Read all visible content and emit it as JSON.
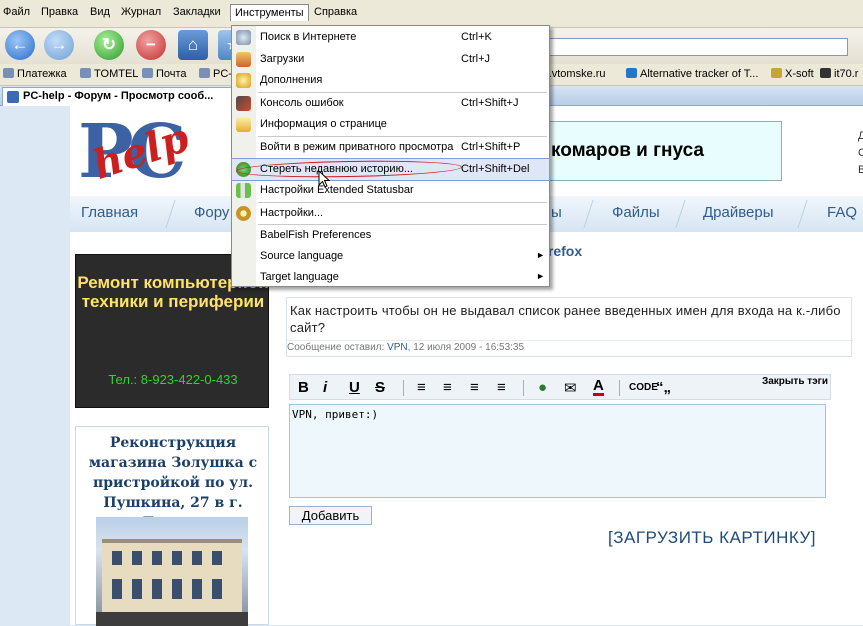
{
  "menubar": {
    "items": [
      "Файл",
      "Правка",
      "Вид",
      "Журнал",
      "Закладки",
      "Инструменты",
      "Справка"
    ],
    "active": "Инструменты"
  },
  "toolbar": {
    "icons": [
      "back-icon",
      "forward-icon",
      "reload-icon",
      "stop-icon",
      "home-icon",
      "bookmark-page-icon"
    ]
  },
  "bookmarks": [
    "Платежка",
    "TOMTEL",
    "Почта",
    "PC-",
    "nts.vtomske.ru",
    "Alternative tracker of T...",
    "X-soft",
    "it70.r"
  ],
  "tab": {
    "title": "PC-help - Форум - Просмотр сооб..."
  },
  "site": {
    "logo_letters": "PC",
    "logo_script": "help",
    "banner_text": "комаров и гнуса",
    "side_letters": [
      "Д",
      "С",
      "В"
    ],
    "nav": [
      "Главная",
      "Фору",
      "ы",
      "Файлы",
      "Драйверы",
      "FAQ"
    ],
    "ad_title": "Ремонт компьютерной техники и периферии",
    "ad_phone_label": "Тел.: ",
    "ad_phone": "8-923-422-0-433",
    "ad2_title": "Реконструкция магазина Золушка с пристройкой по ул. Пушкина, 27 в г. Томске",
    "thread_title": "irefox",
    "post_text": "Как настроить чтобы он не выдавал список ранее введенных имен для входа на к.-либо сайт?",
    "post_meta_prefix": "Сообщение оставил: ",
    "post_author": "VPN",
    "post_date": ", 12 июля 2009 - 16:53:35",
    "editor_buttons": [
      "B",
      "i",
      "U",
      "S",
      "CODE"
    ],
    "close_tags": "Закрыть тэги",
    "reply_text": "VPN, привет:)",
    "add_button": "Добавить",
    "upload_link": "[ЗАГРУЗИТЬ КАРТИНКУ]"
  },
  "dropdown": {
    "items": [
      {
        "label": "Поиск в Интернете",
        "shortcut": "Ctrl+K",
        "icon": "search-icon"
      },
      {
        "label": "Загрузки",
        "shortcut": "Ctrl+J",
        "icon": "downloads-icon"
      },
      {
        "label": "Дополнения",
        "shortcut": "",
        "icon": "addons-icon"
      },
      {
        "label": "Консоль ошибок",
        "shortcut": "Ctrl+Shift+J",
        "icon": "error-console-icon"
      },
      {
        "label": "Информация о странице",
        "shortcut": "",
        "icon": "page-info-icon"
      },
      {
        "label": "Войти в режим приватного просмотра",
        "shortcut": "Ctrl+Shift+P",
        "icon": ""
      },
      {
        "label": "Стереть недавнюю историю...",
        "shortcut": "Ctrl+Shift+Del",
        "icon": "clear-history-icon"
      },
      {
        "label": "Настройки Extended Statusbar",
        "shortcut": "",
        "icon": "statusbar-icon"
      },
      {
        "label": "Настройки...",
        "shortcut": "",
        "icon": "settings-icon"
      },
      {
        "label": "BabelFish Preferences",
        "shortcut": "",
        "icon": ""
      },
      {
        "label": "Source language",
        "shortcut": "",
        "icon": ""
      },
      {
        "label": "Target language",
        "shortcut": "",
        "icon": ""
      }
    ],
    "highlighted": "Стереть недавнюю историю..."
  }
}
